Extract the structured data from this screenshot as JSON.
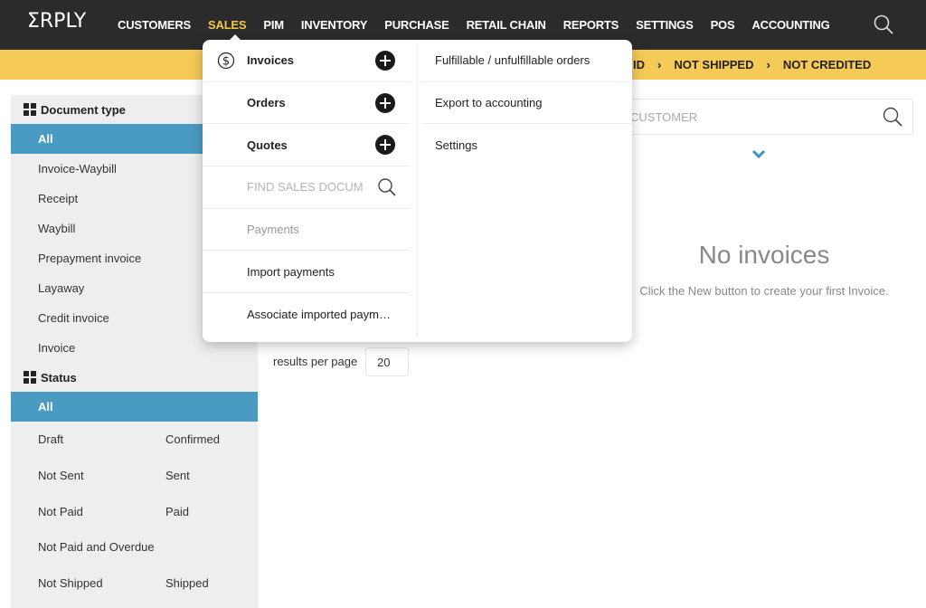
{
  "brand": {
    "logo_text": "ΣRPLY"
  },
  "nav": {
    "items": [
      {
        "label": "CUSTOMERS",
        "active": false
      },
      {
        "label": "SALES",
        "active": true
      },
      {
        "label": "PIM",
        "active": false
      },
      {
        "label": "INVENTORY",
        "active": false
      },
      {
        "label": "PURCHASE",
        "active": false
      },
      {
        "label": "RETAIL CHAIN",
        "active": false
      },
      {
        "label": "REPORTS",
        "active": false
      },
      {
        "label": "SETTINGS",
        "active": false
      },
      {
        "label": "POS",
        "active": false
      },
      {
        "label": "ACCOUNTING",
        "active": false
      }
    ],
    "search_icon": "search-icon"
  },
  "breadcrumb": {
    "items": [
      "ID",
      "NOT SHIPPED",
      "NOT CREDITED"
    ],
    "separator": "›"
  },
  "sidebar": {
    "document_type": {
      "title": "Document type",
      "items": [
        {
          "label": "All",
          "active": true
        },
        {
          "label": "Invoice-Waybill"
        },
        {
          "label": "Receipt"
        },
        {
          "label": "Waybill"
        },
        {
          "label": "Prepayment invoice"
        },
        {
          "label": "Layaway"
        },
        {
          "label": "Credit invoice"
        },
        {
          "label": "Invoice"
        }
      ]
    },
    "status": {
      "title": "Status",
      "all_label": "All",
      "rows": [
        [
          "Draft",
          "Confirmed"
        ],
        [
          "Not Sent",
          "Sent"
        ],
        [
          "Not Paid",
          "Paid"
        ],
        [
          "Not Paid and Overdue",
          ""
        ],
        [
          "Not Shipped",
          "Shipped"
        ]
      ]
    }
  },
  "main": {
    "customer_search": {
      "placeholder": "CUSTOMER",
      "value": ""
    },
    "empty_state": {
      "title": "No invoices",
      "subtitle": "Click the New button to create your first Invoice."
    },
    "results_per_page": {
      "label": "results per page",
      "value": "20"
    }
  },
  "dropdown": {
    "left": [
      {
        "label": "Invoices",
        "style": "bold",
        "icon": "dollar-circle-icon",
        "has_add": true
      },
      {
        "label": "Orders",
        "style": "bold",
        "has_add": true
      },
      {
        "label": "Quotes",
        "style": "bold",
        "has_add": true
      },
      {
        "type": "search",
        "placeholder": "FIND SALES DOCUM"
      },
      {
        "label": "Payments",
        "style": "muted"
      },
      {
        "label": "Import payments",
        "style": "normal"
      },
      {
        "label": "Associate imported paym…",
        "style": "normal"
      }
    ],
    "right": [
      {
        "label": "Fulfillable / unfulfillable orders"
      },
      {
        "label": "Export to accounting"
      },
      {
        "label": "Settings"
      }
    ]
  },
  "colors": {
    "topbar": "#2b2b2b",
    "accent_yellow": "#f5ca57",
    "active_nav": "#f5c84c",
    "selected_blue": "#4a9bc2",
    "sidebar_bg": "#eeeeee"
  }
}
